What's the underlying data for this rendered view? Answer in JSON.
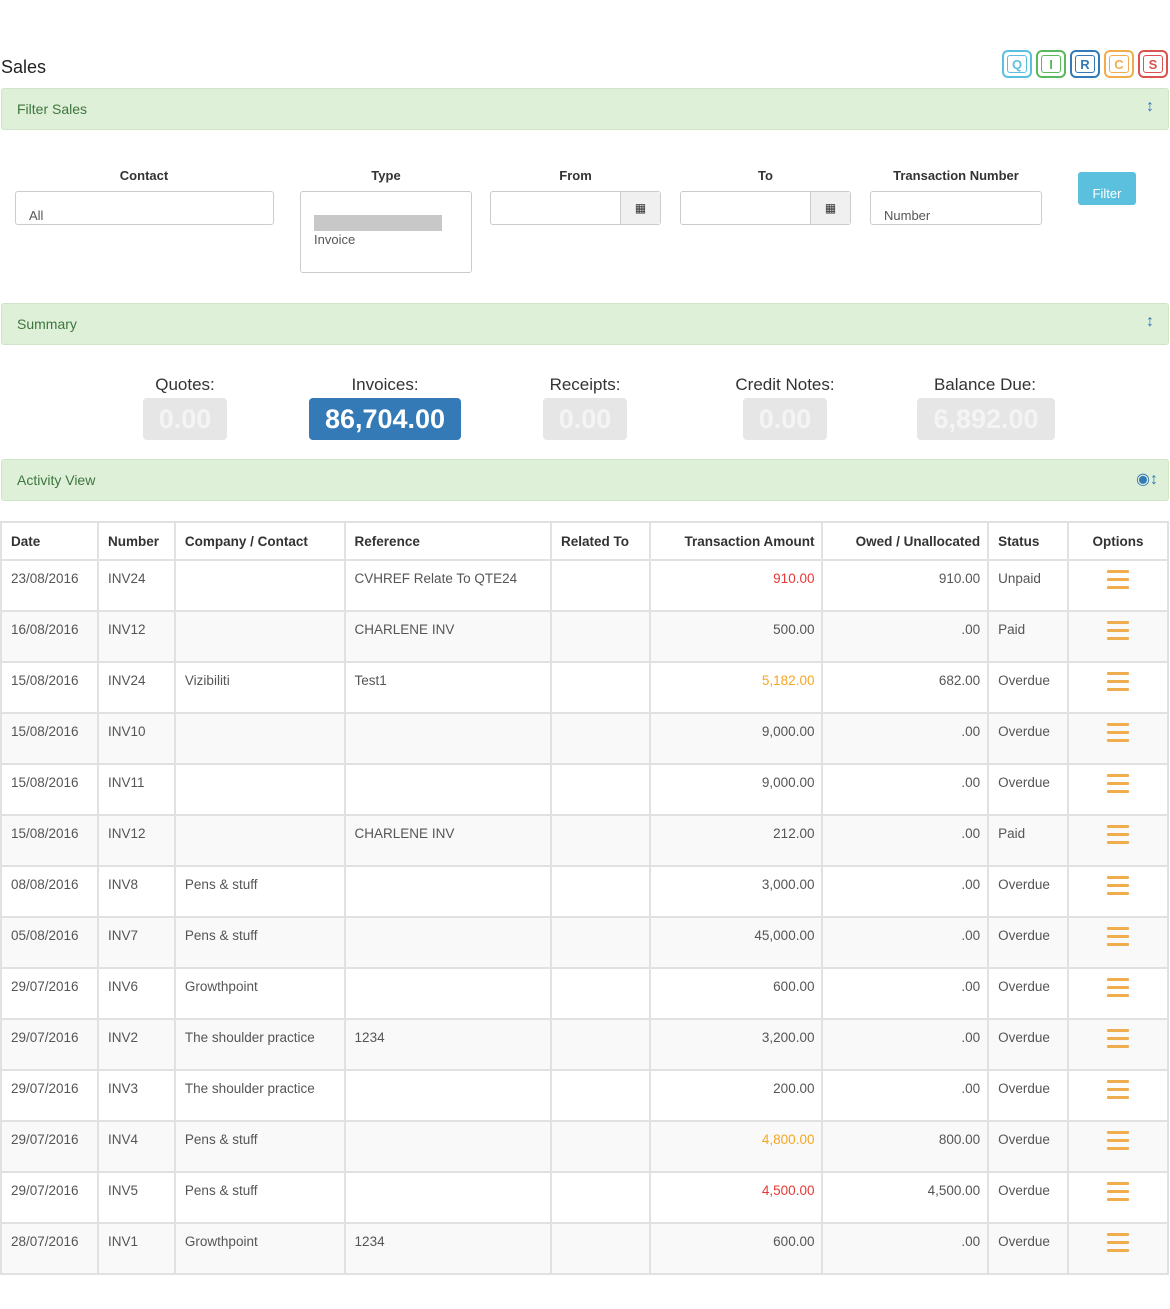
{
  "page": {
    "title": "Sales"
  },
  "quick_buttons": [
    {
      "label": "Q",
      "color": "#5bc0de"
    },
    {
      "label": "I",
      "color": "#5cb85c"
    },
    {
      "label": "R",
      "color": "#337ab7"
    },
    {
      "label": "C",
      "color": "#f0ad4e"
    },
    {
      "label": "S",
      "color": "#d9534f"
    }
  ],
  "filter": {
    "panel_title": "Filter Sales",
    "contact_label": "Contact",
    "contact_value": "All",
    "type_label": "Type",
    "type_value": "Invoice",
    "from_label": "From",
    "to_label": "To",
    "txn_label": "Transaction Number",
    "txn_placeholder": "Number",
    "button": "Filter"
  },
  "summary": {
    "panel_title": "Summary",
    "quotes_label": "Quotes:",
    "quotes_value": "0.00",
    "invoices_label": "Invoices:",
    "invoices_value": "86,704.00",
    "receipts_label": "Receipts:",
    "receipts_value": "0.00",
    "credit_label": "Credit Notes:",
    "credit_value": "0.00",
    "balance_label": "Balance Due:",
    "balance_value": "6,892.00"
  },
  "activity": {
    "panel_title": "Activity View",
    "columns": [
      "Date",
      "Number",
      "Company / Contact",
      "Reference",
      "Related To",
      "Transaction Amount",
      "Owed / Unallocated",
      "Status",
      "Options"
    ],
    "rows": [
      {
        "date": "23/08/2016",
        "number": "INV24",
        "company": "",
        "reference": "CVHREF Relate To QTE24",
        "related": "",
        "amount": "910.00",
        "amount_color": "red",
        "owed": "910.00",
        "status": "Unpaid"
      },
      {
        "date": "16/08/2016",
        "number": "INV12",
        "company": "",
        "reference": "CHARLENE INV",
        "related": "",
        "amount": "500.00",
        "amount_color": "",
        "owed": ".00",
        "status": "Paid"
      },
      {
        "date": "15/08/2016",
        "number": "INV24",
        "company": "Vizibiliti",
        "reference": "Test1",
        "related": "",
        "amount": "5,182.00",
        "amount_color": "orange",
        "owed": "682.00",
        "status": "Overdue"
      },
      {
        "date": "15/08/2016",
        "number": "INV10",
        "company": "",
        "reference": "",
        "related": "",
        "amount": "9,000.00",
        "amount_color": "",
        "owed": ".00",
        "status": "Overdue"
      },
      {
        "date": "15/08/2016",
        "number": "INV11",
        "company": "",
        "reference": "",
        "related": "",
        "amount": "9,000.00",
        "amount_color": "",
        "owed": ".00",
        "status": "Overdue"
      },
      {
        "date": "15/08/2016",
        "number": "INV12",
        "company": "",
        "reference": "CHARLENE INV",
        "related": "",
        "amount": "212.00",
        "amount_color": "",
        "owed": ".00",
        "status": "Paid"
      },
      {
        "date": "08/08/2016",
        "number": "INV8",
        "company": "Pens & stuff",
        "reference": "",
        "related": "",
        "amount": "3,000.00",
        "amount_color": "",
        "owed": ".00",
        "status": "Overdue"
      },
      {
        "date": "05/08/2016",
        "number": "INV7",
        "company": "Pens & stuff",
        "reference": "",
        "related": "",
        "amount": "45,000.00",
        "amount_color": "",
        "owed": ".00",
        "status": "Overdue"
      },
      {
        "date": "29/07/2016",
        "number": "INV6",
        "company": "Growthpoint",
        "reference": "",
        "related": "",
        "amount": "600.00",
        "amount_color": "",
        "owed": ".00",
        "status": "Overdue"
      },
      {
        "date": "29/07/2016",
        "number": "INV2",
        "company": "The shoulder practice",
        "reference": "1234",
        "related": "",
        "amount": "3,200.00",
        "amount_color": "",
        "owed": ".00",
        "status": "Overdue"
      },
      {
        "date": "29/07/2016",
        "number": "INV3",
        "company": "The shoulder practice",
        "reference": "",
        "related": "",
        "amount": "200.00",
        "amount_color": "",
        "owed": ".00",
        "status": "Overdue"
      },
      {
        "date": "29/07/2016",
        "number": "INV4",
        "company": "Pens & stuff",
        "reference": "",
        "related": "",
        "amount": "4,800.00",
        "amount_color": "orange",
        "owed": "800.00",
        "status": "Overdue"
      },
      {
        "date": "29/07/2016",
        "number": "INV5",
        "company": "Pens & stuff",
        "reference": "",
        "related": "",
        "amount": "4,500.00",
        "amount_color": "red",
        "owed": "4,500.00",
        "status": "Overdue"
      },
      {
        "date": "28/07/2016",
        "number": "INV1",
        "company": "Growthpoint",
        "reference": "1234",
        "related": "",
        "amount": "600.00",
        "amount_color": "",
        "owed": ".00",
        "status": "Overdue"
      }
    ]
  }
}
